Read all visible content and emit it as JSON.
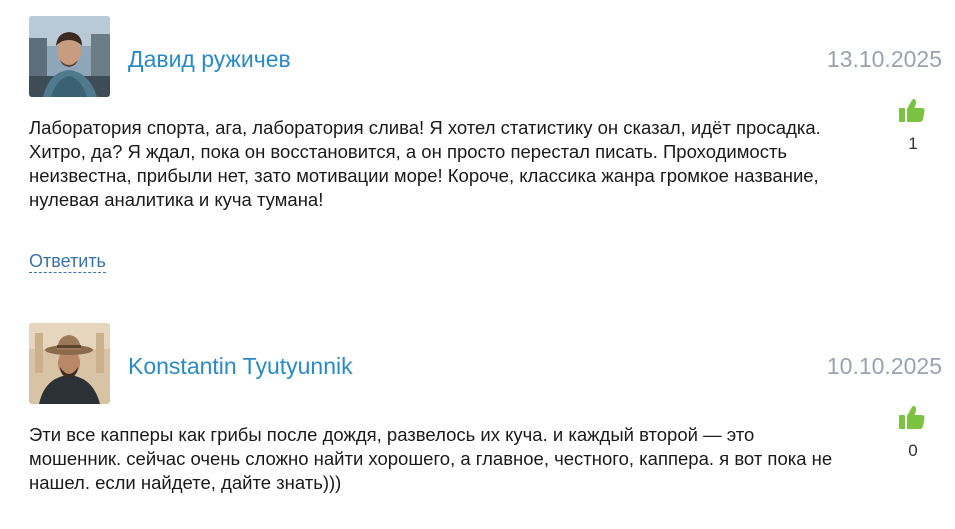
{
  "comments": [
    {
      "author": "Давид ружичев",
      "date": "13.10.2025",
      "text": "Лаборатория спорта, ага, лаборатория слива! Я хотел статистику он сказал, идёт просадка. Хитро, да? Я ждал, пока он восстановится, а он просто перестал писать. Проходимость неизвестна, прибыли нет, зато мотивации море! Короче, классика жанра громкое название, нулевая аналитика и куча тумана!",
      "likes": "1",
      "reply_label": "Ответить",
      "like_icon": "thumbs-up-icon"
    },
    {
      "author": "Konstantin Tyutyunnik",
      "date": "10.10.2025",
      "text": "Эти все капперы как грибы после дождя, развелось их куча. и каждый второй — это мошенник. сейчас очень сложно найти хорошего, а главное, честного, каппера. я вот пока не нашел. если найдете, дайте знать)))",
      "likes": "0",
      "like_icon": "thumbs-up-icon"
    }
  ],
  "colors": {
    "author": "#2a8ac4",
    "date": "#9aa3ad",
    "like_icon": "#7cc242",
    "reply": "#3a72a8"
  }
}
